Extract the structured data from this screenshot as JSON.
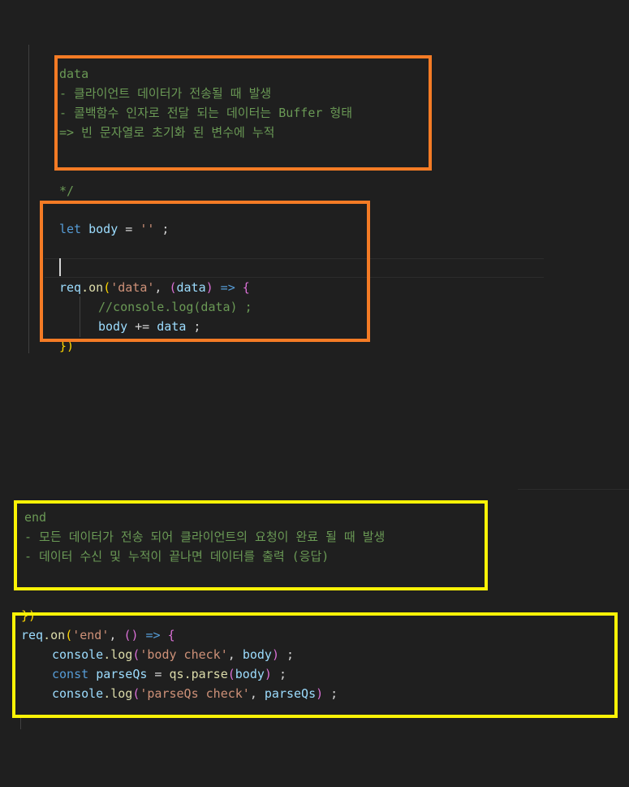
{
  "section1": {
    "comment_lines": [
      "data",
      "- 클라이언트 데이터가 전송될 때 발생",
      "- 콜백함수 인자로 전달 되는 데이터는 Buffer 형태",
      "=> 빈 문자열로 초기화 된 변수에 누적"
    ],
    "comment_close": "*/",
    "let_kw": "let",
    "body_var": "body",
    "assign": " = ",
    "empty_str": "''",
    "semi": " ;",
    "req": "req",
    "dot_on": ".on",
    "data_event": "'data'",
    "data_param": "data",
    "arrow": " => ",
    "inner_comment": "//console.log(data) ;",
    "plus_assign": " += ",
    "close": "})"
  },
  "section2": {
    "comment_lines": [
      "end",
      "- 모든 데이터가 전송 되어 클라이언트의 요청이 완료 될 때 발생",
      "- 데이터 수신 및 누적이 끝나면 데이터를 출력 (응답)"
    ],
    "prev_close": "})",
    "req": "req",
    "dot_on": ".on",
    "end_event": "'end'",
    "arrow": " => ",
    "console": "console",
    "log": ".log",
    "body_check_str": "'body check'",
    "body_var": "body",
    "const_kw": "const",
    "parseQs_var": "parseQs",
    "qs": "qs",
    "parse": ".parse",
    "parseQs_check_str": "'parseQs check'",
    "semi": " ;"
  },
  "colors": {
    "background": "#1f1f1f",
    "comment": "#6a9955",
    "keyword": "#569cd6",
    "variable": "#9cdcfe",
    "function": "#dcdcaa",
    "string": "#ce9178",
    "bracket_gold": "#ffd700",
    "bracket_purple": "#da70d6",
    "highlight_orange": "#f47b25",
    "highlight_yellow": "#fbf206"
  }
}
